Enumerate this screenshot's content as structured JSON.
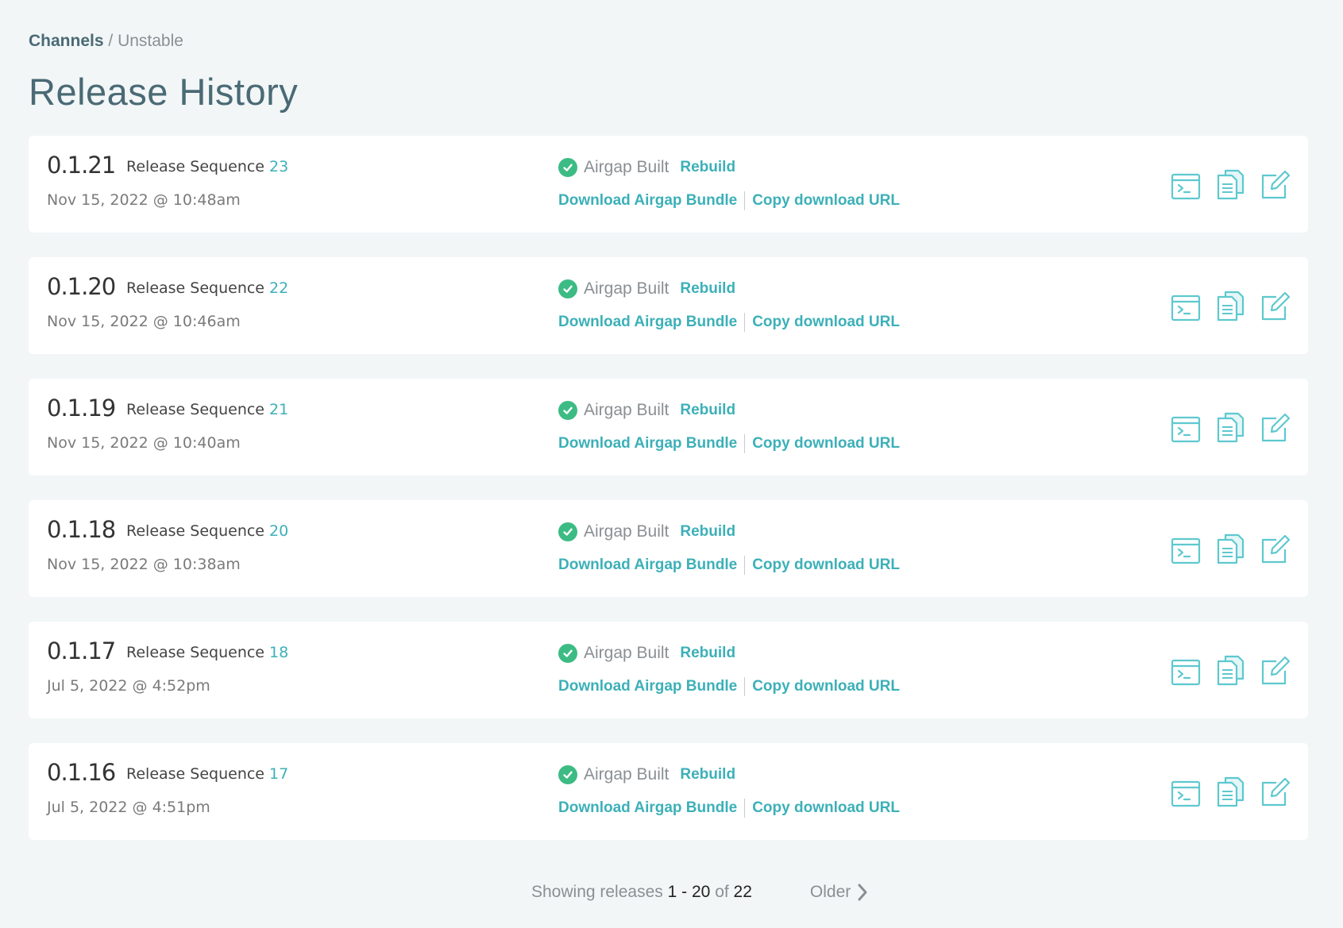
{
  "breadcrumb": {
    "root": "Channels",
    "separator": "/",
    "current": "Unstable"
  },
  "page_title": "Release History",
  "colors": {
    "accent": "#3cb0b8",
    "success": "#3dbb84",
    "title": "#4a6a75"
  },
  "releases": [
    {
      "version": "0.1.21",
      "sequence_label": "Release Sequence",
      "sequence": "23",
      "date": "Nov 15, 2022 @ 10:48am",
      "status": "Airgap Built",
      "rebuild": "Rebuild",
      "download": "Download Airgap Bundle",
      "copy_url": "Copy download URL"
    },
    {
      "version": "0.1.20",
      "sequence_label": "Release Sequence",
      "sequence": "22",
      "date": "Nov 15, 2022 @ 10:46am",
      "status": "Airgap Built",
      "rebuild": "Rebuild",
      "download": "Download Airgap Bundle",
      "copy_url": "Copy download URL"
    },
    {
      "version": "0.1.19",
      "sequence_label": "Release Sequence",
      "sequence": "21",
      "date": "Nov 15, 2022 @ 10:40am",
      "status": "Airgap Built",
      "rebuild": "Rebuild",
      "download": "Download Airgap Bundle",
      "copy_url": "Copy download URL"
    },
    {
      "version": "0.1.18",
      "sequence_label": "Release Sequence",
      "sequence": "20",
      "date": "Nov 15, 2022 @ 10:38am",
      "status": "Airgap Built",
      "rebuild": "Rebuild",
      "download": "Download Airgap Bundle",
      "copy_url": "Copy download URL"
    },
    {
      "version": "0.1.17",
      "sequence_label": "Release Sequence",
      "sequence": "18",
      "date": "Jul 5, 2022 @ 4:52pm",
      "status": "Airgap Built",
      "rebuild": "Rebuild",
      "download": "Download Airgap Bundle",
      "copy_url": "Copy download URL"
    },
    {
      "version": "0.1.16",
      "sequence_label": "Release Sequence",
      "sequence": "17",
      "date": "Jul 5, 2022 @ 4:51pm",
      "status": "Airgap Built",
      "rebuild": "Rebuild",
      "download": "Download Airgap Bundle",
      "copy_url": "Copy download URL"
    }
  ],
  "action_icons": [
    "terminal-icon",
    "release-notes-icon",
    "edit-icon"
  ],
  "pagination": {
    "prefix": "Showing releases",
    "from": "1",
    "dash": "-",
    "to": "20",
    "of": "of",
    "total": "22",
    "older": "Older"
  }
}
